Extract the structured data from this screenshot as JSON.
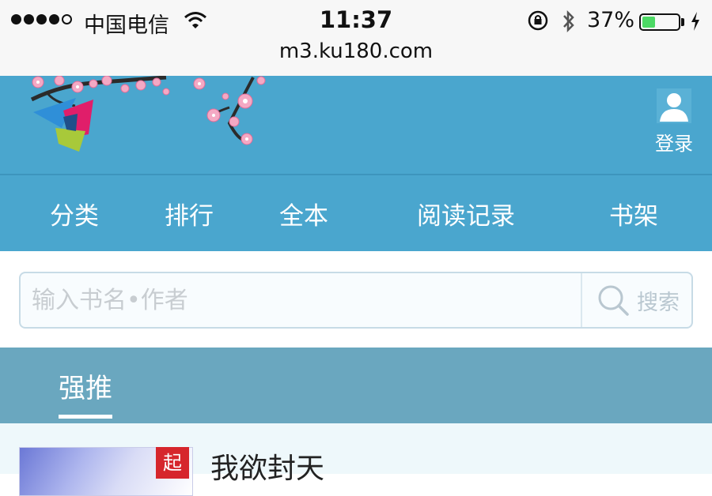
{
  "status_bar": {
    "carrier": "中国电信",
    "time": "11:37",
    "battery_percent": "37%",
    "battery_level": 0.37,
    "url": "m3.ku180.com"
  },
  "header": {
    "login_label": "登录"
  },
  "nav": {
    "items": [
      "分类",
      "排行",
      "全本",
      "阅读记录",
      "书架"
    ]
  },
  "search": {
    "placeholder": "输入书名•作者",
    "button_label": "搜索"
  },
  "tabs": {
    "active": "强推"
  },
  "books": [
    {
      "title": "我欲封天",
      "badge": "起"
    }
  ],
  "colors": {
    "header_bg": "#4aa6ce",
    "tab_bg": "#6aa7bf",
    "battery_green": "#4cd964"
  }
}
